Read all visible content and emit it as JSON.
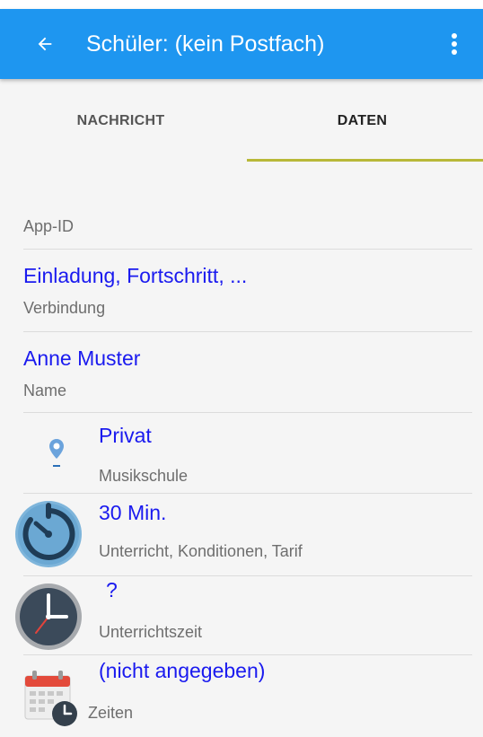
{
  "appbar": {
    "title": "Schüler: (kein Postfach)",
    "back_icon": "arrow-left-icon",
    "menu_icon": "more-vert-icon",
    "color": "#1e96f0"
  },
  "tabs": [
    {
      "label": "NACHRICHT",
      "active": false
    },
    {
      "label": "DATEN",
      "active": true
    }
  ],
  "accent": "#b8b838",
  "link_color": "#1a1aef",
  "list": {
    "app_id": {
      "label": "App-ID"
    },
    "connection": {
      "value": "Einladung, Fortschritt, ...",
      "label": "Verbindung"
    },
    "name": {
      "value": "Anne Muster",
      "label": "Name"
    },
    "school": {
      "value": "Privat",
      "label": "Musikschule",
      "icon": "location-pin-icon"
    },
    "lesson": {
      "value": "30 Min.",
      "label": "Unterricht, Konditionen, Tarif",
      "icon": "timer-icon"
    },
    "lesson_time": {
      "value": "?",
      "label": "Unterrichtszeit",
      "icon": "clock-icon"
    },
    "times": {
      "value": "(nicht angegeben)",
      "label": "Zeiten",
      "icon": "calendar-clock-icon"
    }
  }
}
